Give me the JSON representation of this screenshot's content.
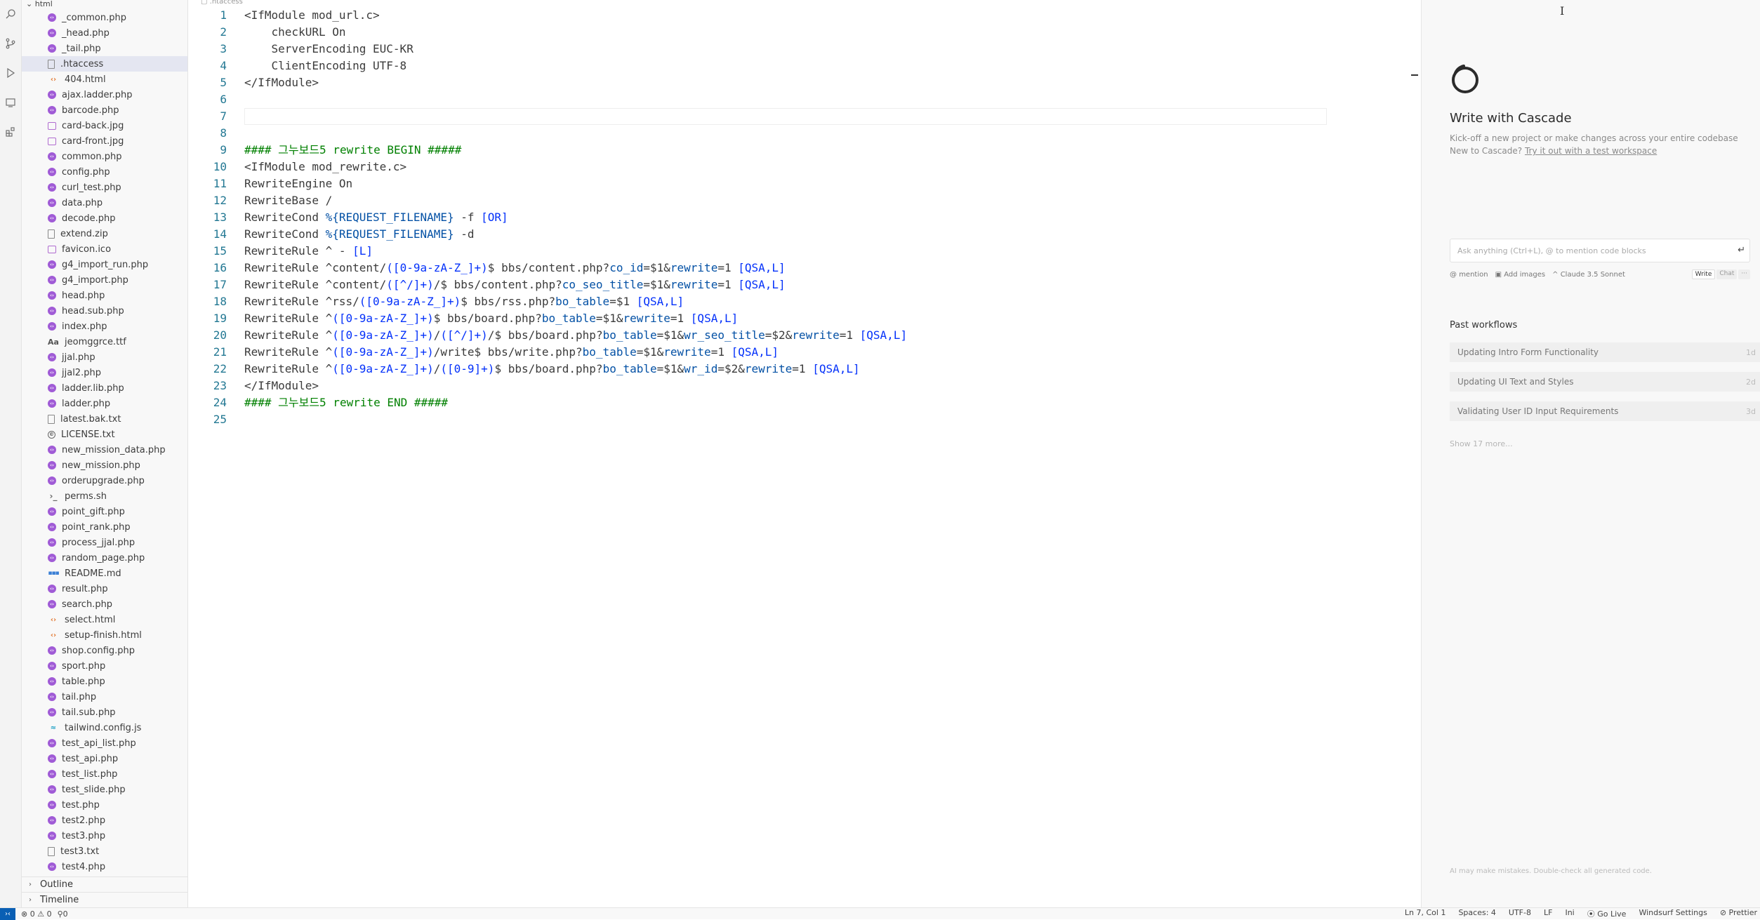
{
  "explorer": {
    "folder": "html",
    "files": [
      {
        "name": "_common.php",
        "type": "php"
      },
      {
        "name": "_head.php",
        "type": "php"
      },
      {
        "name": "_tail.php",
        "type": "php"
      },
      {
        "name": ".htaccess",
        "type": "txt",
        "selected": true
      },
      {
        "name": "404.html",
        "type": "html"
      },
      {
        "name": "ajax.ladder.php",
        "type": "php"
      },
      {
        "name": "barcode.php",
        "type": "php"
      },
      {
        "name": "card-back.jpg",
        "type": "img"
      },
      {
        "name": "card-front.jpg",
        "type": "img"
      },
      {
        "name": "common.php",
        "type": "php"
      },
      {
        "name": "config.php",
        "type": "php"
      },
      {
        "name": "curl_test.php",
        "type": "php"
      },
      {
        "name": "data.php",
        "type": "php"
      },
      {
        "name": "decode.php",
        "type": "php"
      },
      {
        "name": "extend.zip",
        "type": "txt"
      },
      {
        "name": "favicon.ico",
        "type": "img"
      },
      {
        "name": "g4_import_run.php",
        "type": "php"
      },
      {
        "name": "g4_import.php",
        "type": "php"
      },
      {
        "name": "head.php",
        "type": "php"
      },
      {
        "name": "head.sub.php",
        "type": "php"
      },
      {
        "name": "index.php",
        "type": "php"
      },
      {
        "name": "jeomggrce.ttf",
        "type": "font"
      },
      {
        "name": "jjal.php",
        "type": "php"
      },
      {
        "name": "jjal2.php",
        "type": "php"
      },
      {
        "name": "ladder.lib.php",
        "type": "php"
      },
      {
        "name": "ladder.php",
        "type": "php"
      },
      {
        "name": "latest.bak.txt",
        "type": "txt"
      },
      {
        "name": "LICENSE.txt",
        "type": "lic"
      },
      {
        "name": "new_mission_data.php",
        "type": "php"
      },
      {
        "name": "new_mission.php",
        "type": "php"
      },
      {
        "name": "orderupgrade.php",
        "type": "php"
      },
      {
        "name": "perms.sh",
        "type": "sh"
      },
      {
        "name": "point_gift.php",
        "type": "php"
      },
      {
        "name": "point_rank.php",
        "type": "php"
      },
      {
        "name": "process_jjal.php",
        "type": "php"
      },
      {
        "name": "random_page.php",
        "type": "php"
      },
      {
        "name": "README.md",
        "type": "md"
      },
      {
        "name": "result.php",
        "type": "php"
      },
      {
        "name": "search.php",
        "type": "php"
      },
      {
        "name": "select.html",
        "type": "html"
      },
      {
        "name": "setup-finish.html",
        "type": "html"
      },
      {
        "name": "shop.config.php",
        "type": "php"
      },
      {
        "name": "sport.php",
        "type": "php"
      },
      {
        "name": "table.php",
        "type": "php"
      },
      {
        "name": "tail.php",
        "type": "php"
      },
      {
        "name": "tail.sub.php",
        "type": "php"
      },
      {
        "name": "tailwind.config.js",
        "type": "js"
      },
      {
        "name": "test_api_list.php",
        "type": "php"
      },
      {
        "name": "test_api.php",
        "type": "php"
      },
      {
        "name": "test_list.php",
        "type": "php"
      },
      {
        "name": "test_slide.php",
        "type": "php"
      },
      {
        "name": "test.php",
        "type": "php"
      },
      {
        "name": "test2.php",
        "type": "php"
      },
      {
        "name": "test3.php",
        "type": "php"
      },
      {
        "name": "test3.txt",
        "type": "txt"
      },
      {
        "name": "test4.php",
        "type": "php"
      }
    ],
    "outline_label": "Outline",
    "timeline_label": "Timeline"
  },
  "editor": {
    "breadcrumb": ".htaccess",
    "current_line": 7,
    "lines": [
      [
        [
          "kw",
          "<IfModule mod_url.c>"
        ]
      ],
      [
        [
          "kw",
          "    checkURL On"
        ]
      ],
      [
        [
          "kw",
          "    ServerEncoding EUC-KR"
        ]
      ],
      [
        [
          "kw",
          "    ClientEncoding UTF-8"
        ]
      ],
      [
        [
          "kw",
          "</IfModule>"
        ]
      ],
      [],
      [],
      [],
      [
        [
          "cm",
          "#### 그누보드5 rewrite BEGIN #####"
        ]
      ],
      [
        [
          "kw",
          "<IfModule mod_rewrite.c>"
        ]
      ],
      [
        [
          "kw",
          "RewriteEngine On"
        ]
      ],
      [
        [
          "kw",
          "RewriteBase /"
        ]
      ],
      [
        [
          "kw",
          "RewriteCond "
        ],
        [
          "vr",
          "%{REQUEST_FILENAME}"
        ],
        [
          "kw",
          " -f "
        ],
        [
          "br",
          "[OR]"
        ]
      ],
      [
        [
          "kw",
          "RewriteCond "
        ],
        [
          "vr",
          "%{REQUEST_FILENAME}"
        ],
        [
          "kw",
          " -d"
        ]
      ],
      [
        [
          "kw",
          "RewriteRule ^ - "
        ],
        [
          "br",
          "[L]"
        ]
      ],
      [
        [
          "kw",
          "RewriteRule ^content/"
        ],
        [
          "br",
          "([0-9a-zA-Z_]+)"
        ],
        [
          "kw",
          "$ bbs/content.php?"
        ],
        [
          "vr",
          "co_id"
        ],
        [
          "kw",
          "=$1&"
        ],
        [
          "vr",
          "rewrite"
        ],
        [
          "kw",
          "=1 "
        ],
        [
          "br",
          "[QSA,L]"
        ]
      ],
      [
        [
          "kw",
          "RewriteRule ^content/"
        ],
        [
          "br",
          "([^/]+)"
        ],
        [
          "kw",
          "/$ bbs/content.php?"
        ],
        [
          "vr",
          "co_seo_title"
        ],
        [
          "kw",
          "=$1&"
        ],
        [
          "vr",
          "rewrite"
        ],
        [
          "kw",
          "=1 "
        ],
        [
          "br",
          "[QSA,L]"
        ]
      ],
      [
        [
          "kw",
          "RewriteRule ^rss/"
        ],
        [
          "br",
          "([0-9a-zA-Z_]+)"
        ],
        [
          "kw",
          "$ bbs/rss.php?"
        ],
        [
          "vr",
          "bo_table"
        ],
        [
          "kw",
          "=$1 "
        ],
        [
          "br",
          "[QSA,L]"
        ]
      ],
      [
        [
          "kw",
          "RewriteRule ^"
        ],
        [
          "br",
          "([0-9a-zA-Z_]+)"
        ],
        [
          "kw",
          "$ bbs/board.php?"
        ],
        [
          "vr",
          "bo_table"
        ],
        [
          "kw",
          "=$1&"
        ],
        [
          "vr",
          "rewrite"
        ],
        [
          "kw",
          "=1 "
        ],
        [
          "br",
          "[QSA,L]"
        ]
      ],
      [
        [
          "kw",
          "RewriteRule ^"
        ],
        [
          "br",
          "([0-9a-zA-Z_]+)"
        ],
        [
          "kw",
          "/"
        ],
        [
          "br",
          "([^/]+)"
        ],
        [
          "kw",
          "/$ bbs/board.php?"
        ],
        [
          "vr",
          "bo_table"
        ],
        [
          "kw",
          "=$1&"
        ],
        [
          "vr",
          "wr_seo_title"
        ],
        [
          "kw",
          "=$2&"
        ],
        [
          "vr",
          "rewrite"
        ],
        [
          "kw",
          "=1 "
        ],
        [
          "br",
          "[QSA,L]"
        ]
      ],
      [
        [
          "kw",
          "RewriteRule ^"
        ],
        [
          "br",
          "([0-9a-zA-Z_]+)"
        ],
        [
          "kw",
          "/write$ bbs/write.php?"
        ],
        [
          "vr",
          "bo_table"
        ],
        [
          "kw",
          "=$1&"
        ],
        [
          "vr",
          "rewrite"
        ],
        [
          "kw",
          "=1 "
        ],
        [
          "br",
          "[QSA,L]"
        ]
      ],
      [
        [
          "kw",
          "RewriteRule ^"
        ],
        [
          "br",
          "([0-9a-zA-Z_]+)"
        ],
        [
          "kw",
          "/"
        ],
        [
          "br",
          "([0-9]+)"
        ],
        [
          "kw",
          "$ bbs/board.php?"
        ],
        [
          "vr",
          "bo_table"
        ],
        [
          "kw",
          "=$1&"
        ],
        [
          "vr",
          "wr_id"
        ],
        [
          "kw",
          "=$2&"
        ],
        [
          "vr",
          "rewrite"
        ],
        [
          "kw",
          "=1 "
        ],
        [
          "br",
          "[QSA,L]"
        ]
      ],
      [
        [
          "kw",
          "</IfModule>"
        ]
      ],
      [
        [
          "cm",
          "#### 그누보드5 rewrite END #####"
        ]
      ],
      []
    ]
  },
  "cascade": {
    "title": "Write with Cascade",
    "subtitle": "Kick-off a new project or make changes across your entire codebase",
    "new_prefix": "New to Cascade? ",
    "new_link": "Try it out with a test workspace",
    "input_placeholder": "Ask anything (Ctrl+L), @ to mention code blocks",
    "mention_label": "mention",
    "add_images_label": "Add images",
    "model_label": "Claude 3.5 Sonnet",
    "mode_write": "Write",
    "mode_chat": "Chat",
    "past_title": "Past workflows",
    "workflows": [
      {
        "title": "Updating Intro Form Functionality",
        "age": "1d"
      },
      {
        "title": "Updating UI Text and Styles",
        "age": "2d"
      },
      {
        "title": "Validating User ID Input Requirements",
        "age": "3d"
      }
    ],
    "show_more": "Show 17 more...",
    "disclaimer": "AI may make mistakes. Double-check all generated code."
  },
  "status": {
    "errors": "0",
    "warnings": "0",
    "ports": "0",
    "position": "Ln 7, Col 1",
    "spaces": "Spaces: 4",
    "encoding": "UTF-8",
    "eol": "LF",
    "language": "Ini",
    "golive": "Go Live",
    "windsurf": "Windsurf Settings",
    "prettier": "Prettier"
  }
}
